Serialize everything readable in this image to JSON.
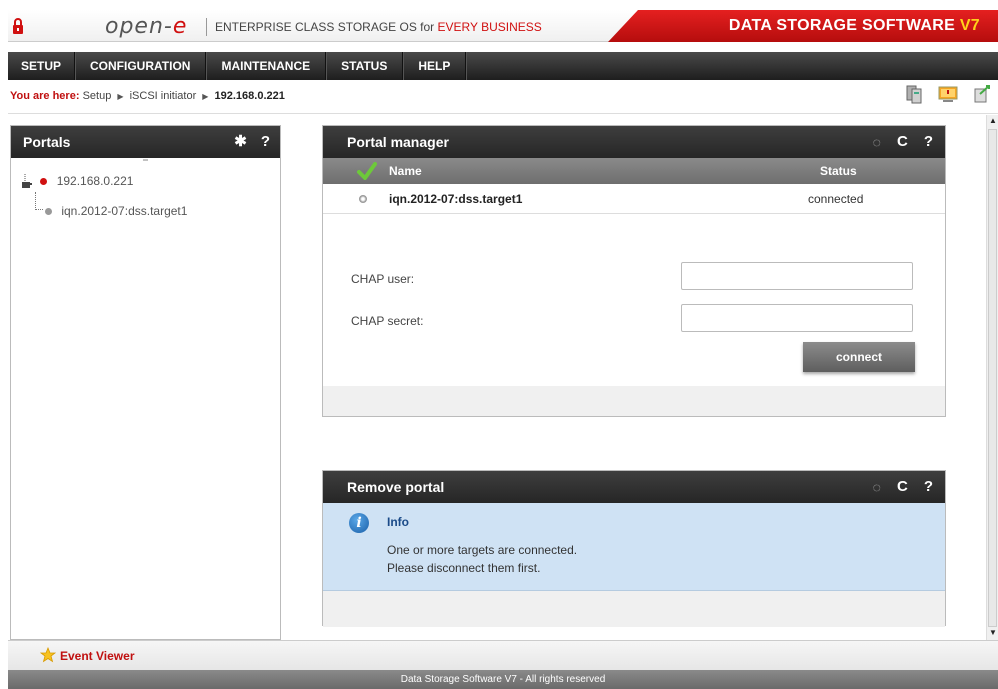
{
  "header": {
    "logo_text": "open-",
    "logo_accent": "e",
    "tagline_prefix": "ENTERPRISE CLASS STORAGE OS for ",
    "tagline_accent": "EVERY BUSINESS",
    "brand": "DATA STORAGE SOFTWARE ",
    "brand_version": "V7"
  },
  "nav": {
    "items": [
      "SETUP",
      "CONFIGURATION",
      "MAINTENANCE",
      "STATUS",
      "HELP"
    ]
  },
  "breadcrumb": {
    "prefix": "You are here:",
    "items": [
      "Setup",
      "iSCSI initiator"
    ],
    "current": "192.168.0.221"
  },
  "portals": {
    "title": "Portals",
    "root": "192.168.0.221",
    "child": "iqn.2012-07:dss.target1"
  },
  "portal_manager": {
    "title": "Portal manager",
    "columns": {
      "name": "Name",
      "status": "Status"
    },
    "rows": [
      {
        "name": "iqn.2012-07:dss.target1",
        "status": "connected"
      }
    ],
    "chap_user_label": "CHAP user:",
    "chap_secret_label": "CHAP secret:",
    "chap_user_value": "",
    "chap_secret_value": "",
    "connect_label": "connect"
  },
  "remove_portal": {
    "title": "Remove portal",
    "info_title": "Info",
    "info_line1": "One or more targets are connected.",
    "info_line2": "Please disconnect them first."
  },
  "footer": {
    "event_viewer": "Event Viewer",
    "copyright": "Data Storage Software V7 - All rights reserved"
  },
  "icons": {
    "settings": "gear-icon",
    "help": "help-icon",
    "refresh": "refresh-icon",
    "spinner": "spinner-icon"
  },
  "colors": {
    "accent_red": "#d01010",
    "header_dark": "#2e2e2e",
    "info_bg": "#cfe2f4"
  }
}
